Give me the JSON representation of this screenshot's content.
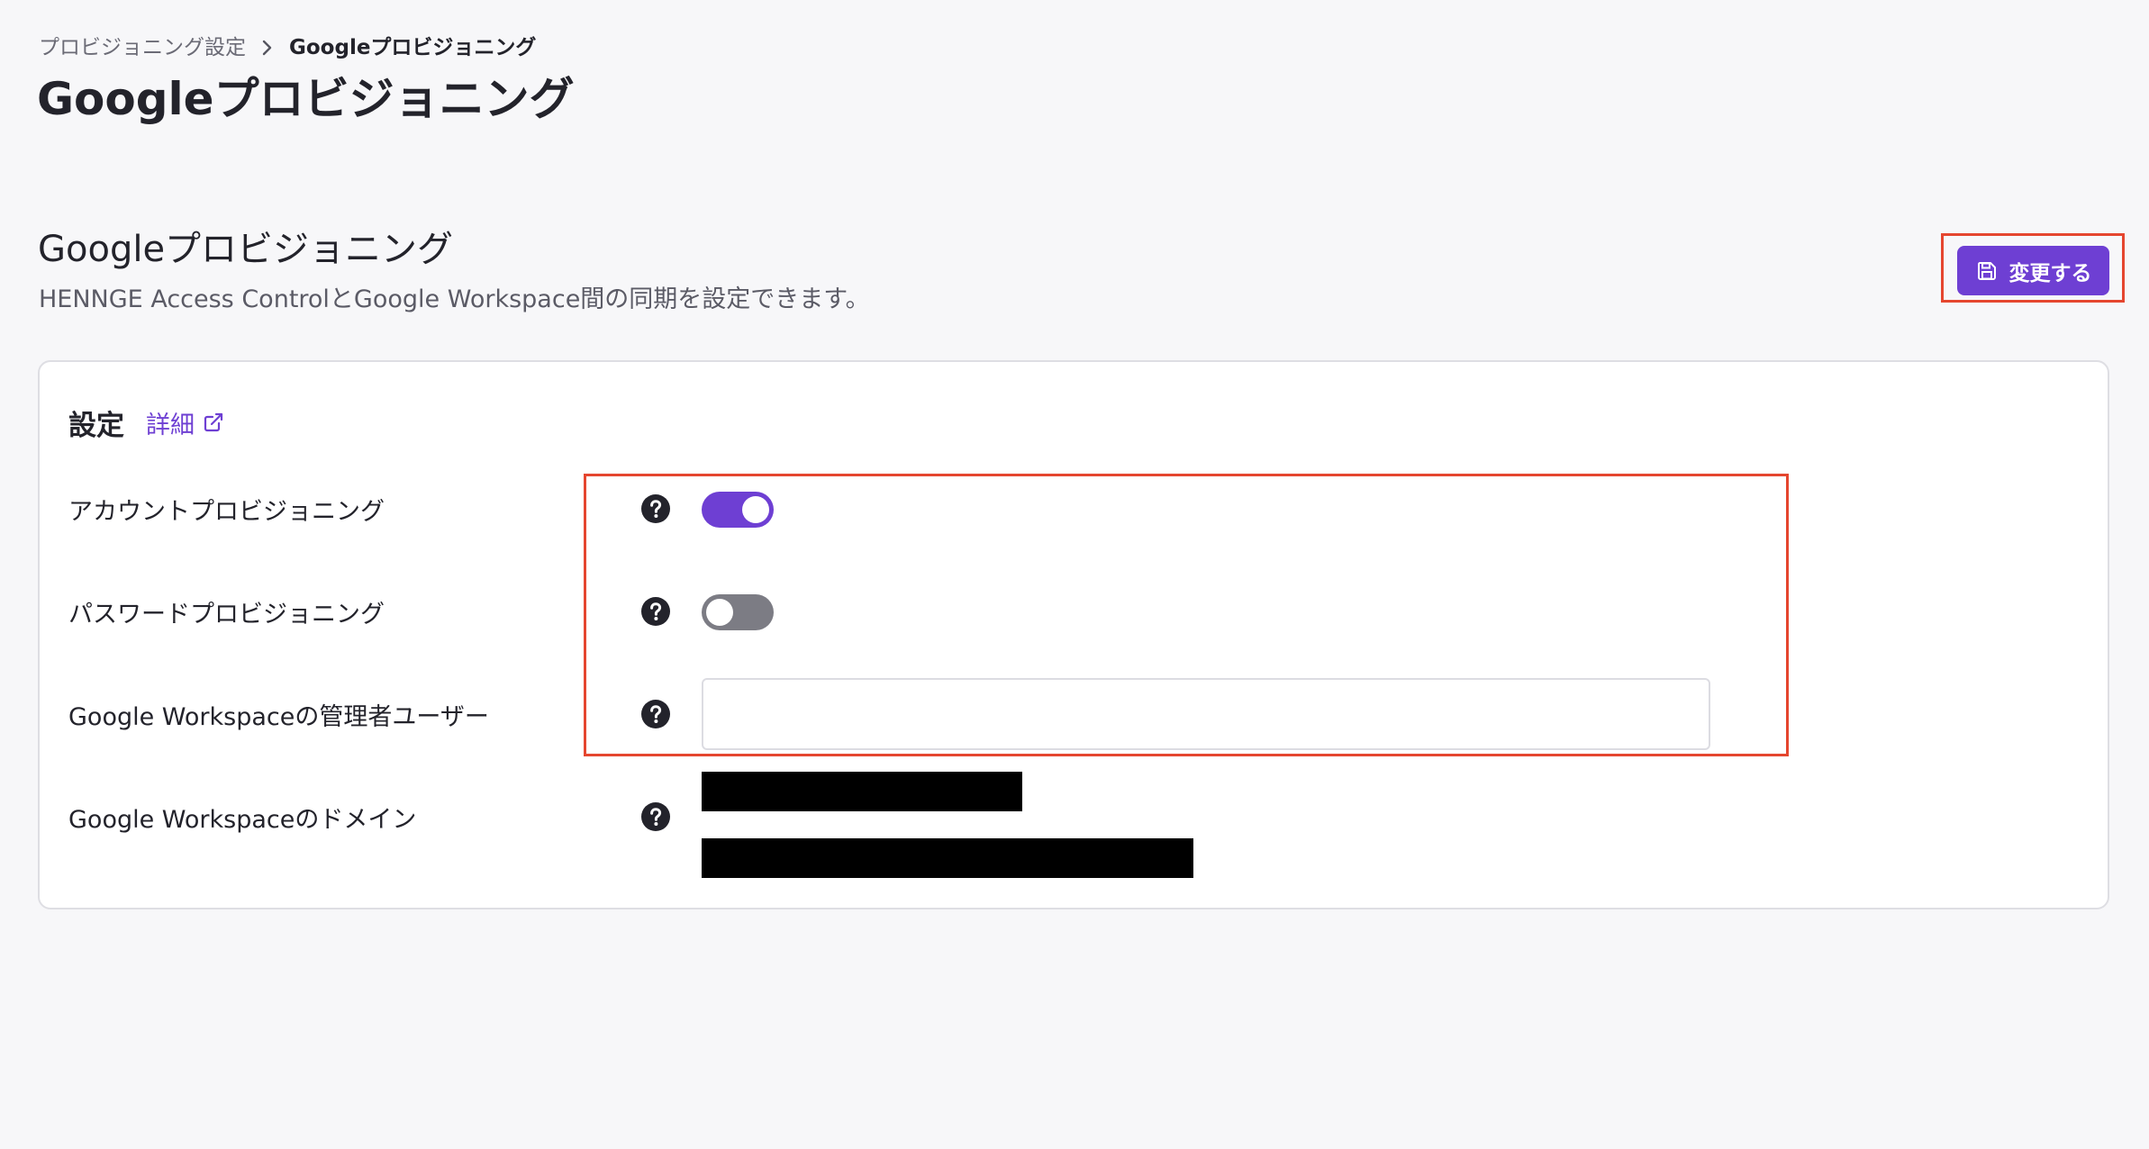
{
  "breadcrumb": {
    "parent": "プロビジョニング設定",
    "current": "Googleプロビジョニング"
  },
  "page": {
    "title": "Googleプロビジョニング"
  },
  "section": {
    "title": "Googleプロビジョニング",
    "description": "HENNGE Access ControlとGoogle Workspace間の同期を設定できます。"
  },
  "toolbar": {
    "save_label": "変更する"
  },
  "settings": {
    "title": "設定",
    "details_link": "詳細",
    "rows": [
      {
        "label": "アカウントプロビジョニング",
        "control": "toggle",
        "checked": true
      },
      {
        "label": "パスワードプロビジョニング",
        "control": "toggle",
        "checked": false
      },
      {
        "label": "Google Workspaceの管理者ユーザー",
        "control": "text-input",
        "value": "",
        "placeholder": ""
      },
      {
        "label": "Google Workspaceのドメイン",
        "control": "redacted-values",
        "values_redacted": true
      }
    ]
  },
  "colors": {
    "accent": "#6e3fd3",
    "toggle_off": "#7c7c84",
    "annotation": "#e5462f",
    "background": "#f7f7f9"
  },
  "icons": {
    "breadcrumb_separator": "chevron-right-icon",
    "save": "floppy-disk-icon",
    "details": "external-link-icon",
    "help": "question-circle-icon"
  }
}
